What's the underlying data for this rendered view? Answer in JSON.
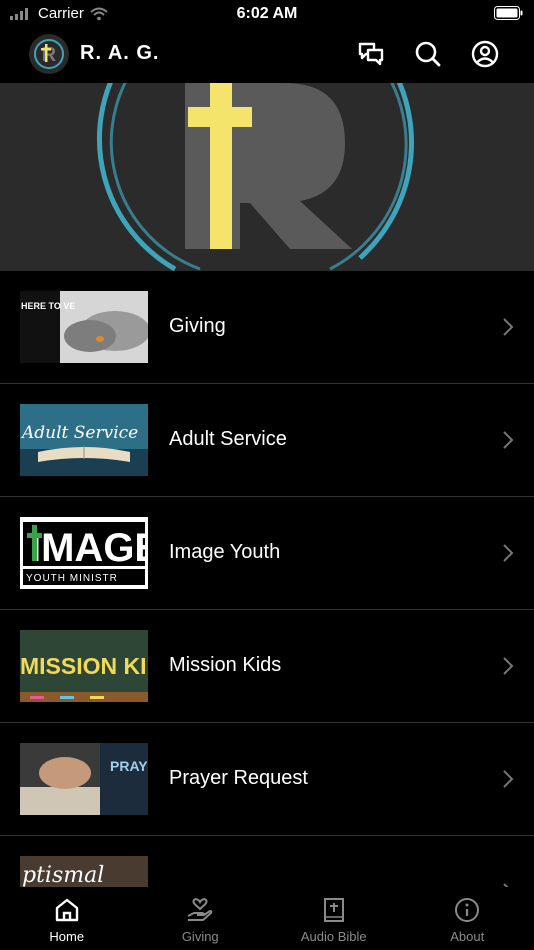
{
  "status": {
    "carrier": "Carrier",
    "time": "6:02 AM"
  },
  "header": {
    "title": "R. A. G."
  },
  "menu": [
    {
      "label": "Giving",
      "thumb_text": "HERE TO VE"
    },
    {
      "label": "Adult Service",
      "thumb_text": "Adult Service"
    },
    {
      "label": "Image Youth",
      "thumb_text": "IMAGE",
      "thumb_subtext": "YOUTH MINISTR"
    },
    {
      "label": "Mission Kids",
      "thumb_text": "MISSION KIDS"
    },
    {
      "label": "Prayer Request",
      "thumb_text": "PRAYE REQU"
    },
    {
      "label": "",
      "thumb_text": "ptismal"
    }
  ],
  "tabs": [
    {
      "label": "Home",
      "icon": "home-icon",
      "active": true
    },
    {
      "label": "Giving",
      "icon": "giving-hand-icon",
      "active": false
    },
    {
      "label": "Audio Bible",
      "icon": "bible-icon",
      "active": false
    },
    {
      "label": "About",
      "icon": "info-icon",
      "active": false
    }
  ],
  "colors": {
    "accent_teal": "#3fa3b9",
    "cross_yellow": "#f4e46b",
    "background": "#000000"
  }
}
